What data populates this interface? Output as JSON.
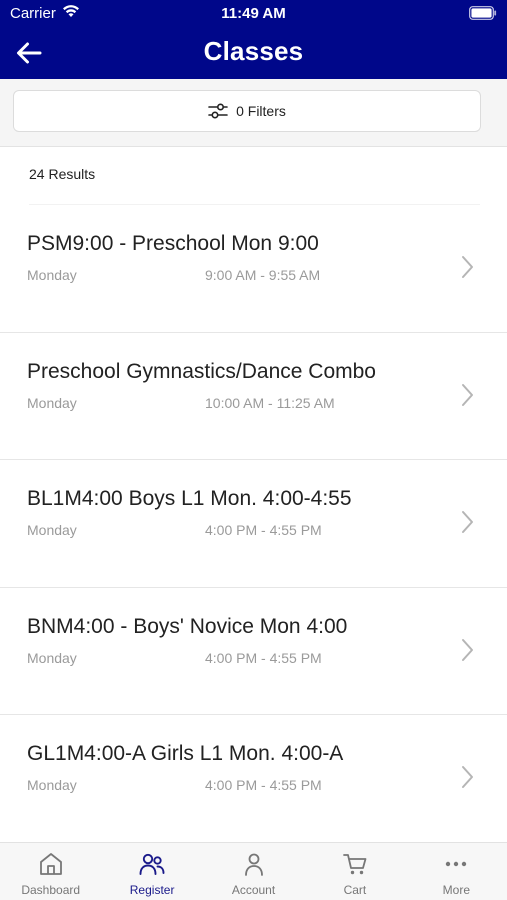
{
  "status_bar": {
    "carrier": "Carrier",
    "time": "11:49 AM"
  },
  "header": {
    "title": "Classes",
    "back_icon": "arrow-left-icon",
    "background_color": "#00078a"
  },
  "filters": {
    "label": "0 Filters",
    "icon": "sliders-icon"
  },
  "results": {
    "label": "24 Results"
  },
  "classes": [
    {
      "title": "PSM9:00 - Preschool Mon 9:00",
      "day": "Monday",
      "time": "9:00 AM - 9:55 AM"
    },
    {
      "title": "Preschool Gymnastics/Dance Combo",
      "day": "Monday",
      "time": "10:00 AM - 11:25 AM"
    },
    {
      "title": "BL1M4:00 Boys L1 Mon. 4:00-4:55",
      "day": "Monday",
      "time": "4:00 PM - 4:55 PM"
    },
    {
      "title": "BNM4:00 - Boys' Novice Mon 4:00",
      "day": "Monday",
      "time": "4:00 PM - 4:55 PM"
    },
    {
      "title": "GL1M4:00-A Girls L1 Mon. 4:00-A",
      "day": "Monday",
      "time": "4:00 PM - 4:55 PM"
    }
  ],
  "tab_bar": {
    "active_color": "#1a1a8a",
    "tabs": [
      {
        "label": "Dashboard",
        "icon": "home-icon",
        "active": false
      },
      {
        "label": "Register",
        "icon": "users-icon",
        "active": true
      },
      {
        "label": "Account",
        "icon": "person-icon",
        "active": false
      },
      {
        "label": "Cart",
        "icon": "cart-icon",
        "active": false
      },
      {
        "label": "More",
        "icon": "more-icon",
        "active": false
      }
    ]
  }
}
